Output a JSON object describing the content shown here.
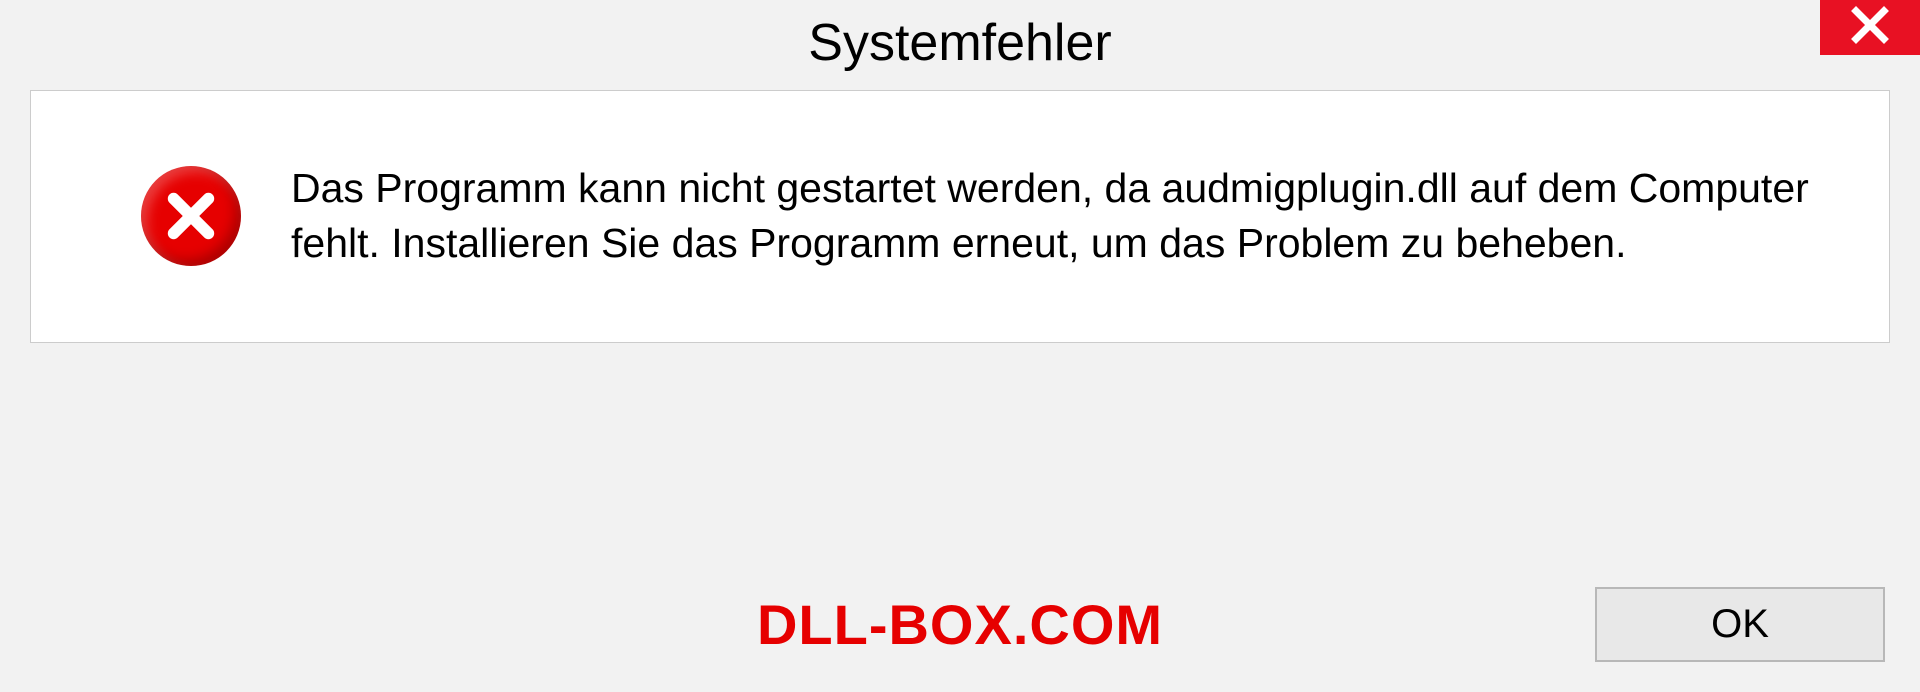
{
  "dialog": {
    "title": "Systemfehler",
    "message": "Das Programm kann nicht gestartet werden, da audmigplugin.dll auf dem Computer fehlt. Installieren Sie das Programm erneut, um das Problem zu beheben.",
    "ok_label": "OK"
  },
  "watermark": "DLL-BOX.COM"
}
